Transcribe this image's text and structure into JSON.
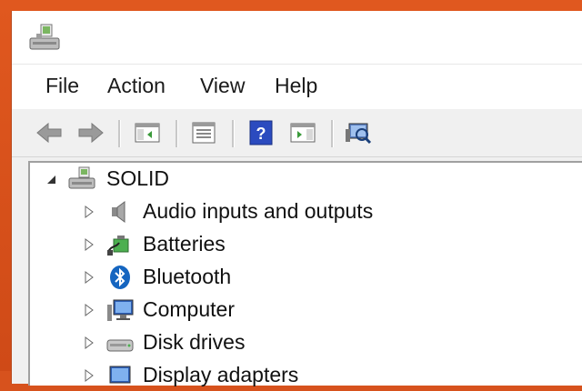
{
  "menu": {
    "file": "File",
    "action": "Action",
    "view": "View",
    "help": "Help"
  },
  "toolbar": {
    "icons": [
      "back-arrow-icon",
      "forward-arrow-icon",
      "show-hide-console-tree-icon",
      "properties-icon",
      "help-icon",
      "show-action-pane-icon",
      "scan-hardware-icon"
    ]
  },
  "tree": {
    "root": {
      "label": "SOLID",
      "icon": "computer-tower-icon",
      "expanded": true
    },
    "children": [
      {
        "label": "Audio inputs and outputs",
        "icon": "speaker-icon"
      },
      {
        "label": "Batteries",
        "icon": "battery-icon"
      },
      {
        "label": "Bluetooth",
        "icon": "bluetooth-icon"
      },
      {
        "label": "Computer",
        "icon": "monitor-icon"
      },
      {
        "label": "Disk drives",
        "icon": "disk-drive-icon"
      },
      {
        "label": "Display adapters",
        "icon": "display-adapter-icon"
      }
    ]
  },
  "colors": {
    "desktop": "#d7521d",
    "bluetooth": "#1565c0",
    "help_blue": "#2b4bbf"
  }
}
